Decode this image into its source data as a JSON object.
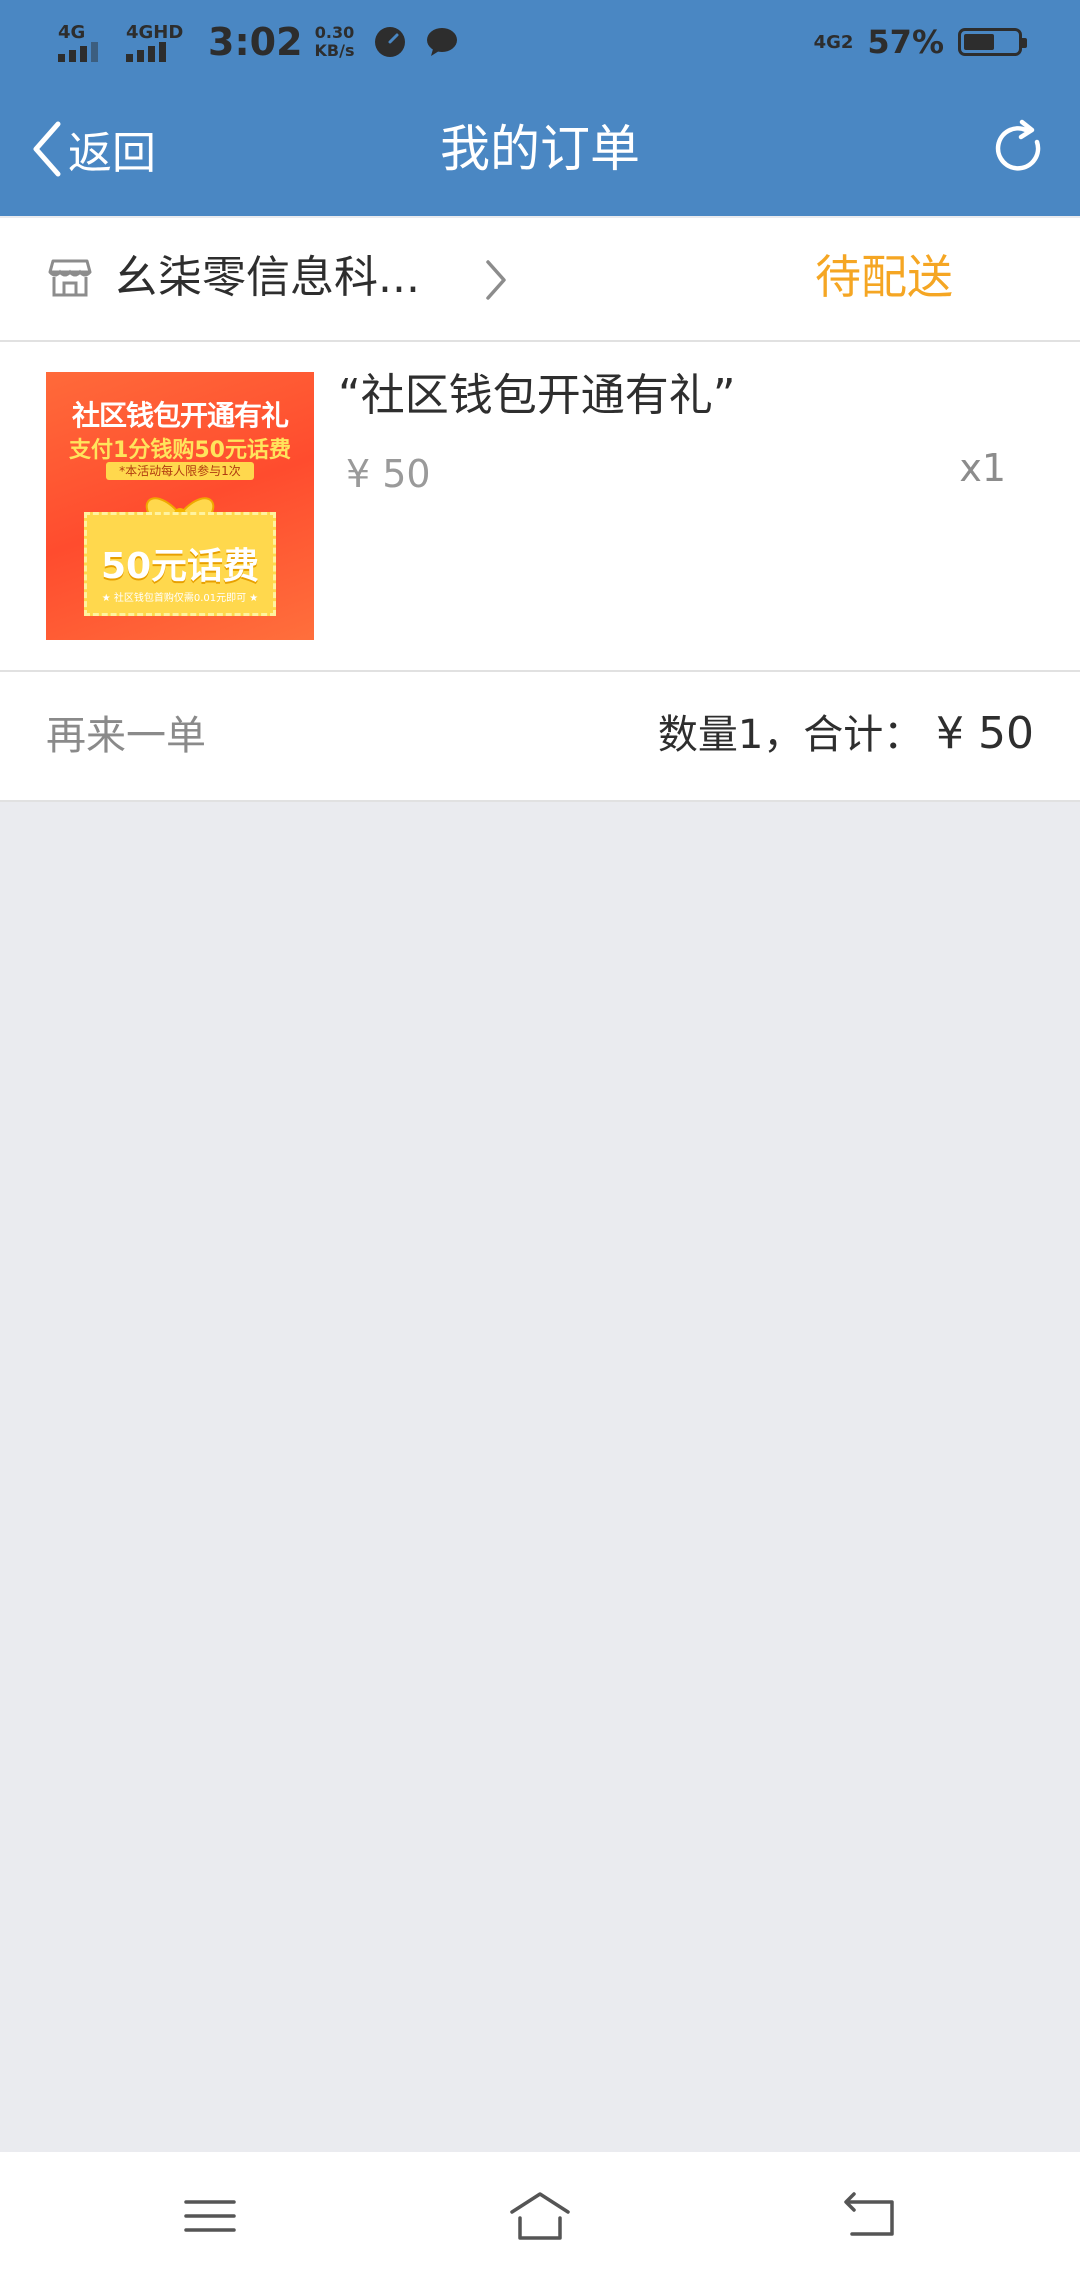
{
  "status_bar": {
    "sim1": "4G",
    "sim2": "4GHD",
    "time": "3:02",
    "speed_value": "0.30",
    "speed_unit": "KB/s",
    "network_right": "4G2",
    "battery_percent": "57%",
    "battery_level": 0.57
  },
  "nav": {
    "back_label": "返回",
    "title": "我的订单"
  },
  "shop": {
    "name": "幺柒零信息科...",
    "status": "待配送",
    "status_color": "#f5a623"
  },
  "product": {
    "title": "“社区钱包开通有礼”",
    "price": "¥ 50",
    "quantity": "x1",
    "image_text": {
      "headline": "社区钱包开通有礼",
      "subline": "支付1分钱购50元话费",
      "note": "*本活动每人限参与1次",
      "big": "50元话费",
      "small": "★ 社区钱包首购仅需0.01元即可 ★"
    }
  },
  "order_footer": {
    "reorder_label": "再来一单",
    "summary_label": "数量1，合计：",
    "total_amount": "¥ 50"
  },
  "colors": {
    "primary": "#4a87c3",
    "background": "#eaebef",
    "accent": "#f5a623"
  },
  "icons": [
    "back-chevron-icon",
    "refresh-icon",
    "store-icon",
    "chevron-right-icon",
    "menu-icon",
    "home-icon",
    "back-nav-icon"
  ]
}
